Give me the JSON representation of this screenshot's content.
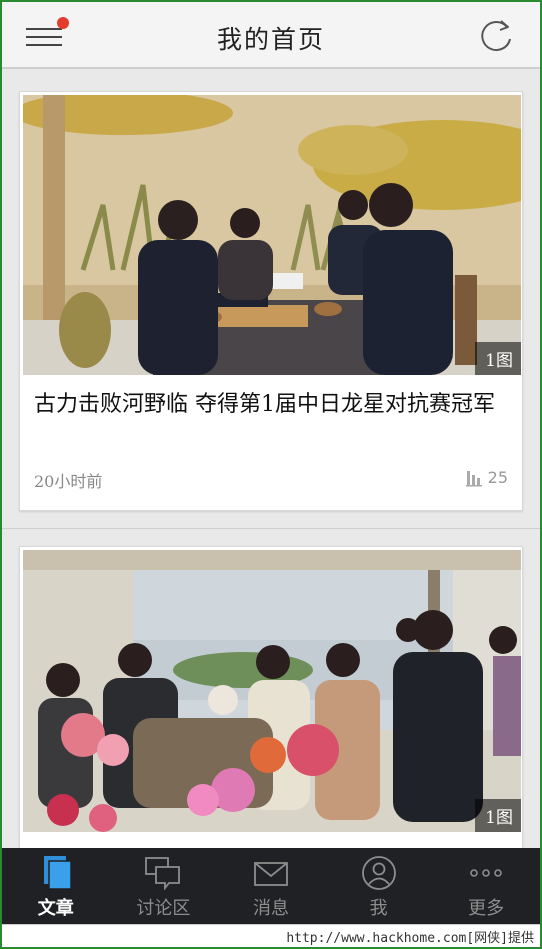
{
  "header": {
    "title": "我的首页",
    "menu_icon": "hamburger-menu-icon",
    "notification_dot_color": "#e33b2c",
    "refresh_icon": "refresh-icon"
  },
  "articles": [
    {
      "title": "古力击败河野临 夺得第1届中日龙星对抗赛冠军",
      "image_count": "1图",
      "time": "20小时前",
      "views": "25"
    },
    {
      "title": "",
      "image_count": "1图",
      "time": "",
      "views": ""
    }
  ],
  "tabbar": {
    "items": [
      {
        "label": "文章",
        "icon": "document-icon",
        "active": true
      },
      {
        "label": "讨论区",
        "icon": "chat-bubbles-icon",
        "active": false
      },
      {
        "label": "消息",
        "icon": "envelope-icon",
        "active": false
      },
      {
        "label": "我",
        "icon": "user-icon",
        "active": false
      },
      {
        "label": "更多",
        "icon": "more-dots-icon",
        "active": false
      }
    ],
    "active_color": "#ffffff",
    "inactive_color": "#8d8d8d",
    "background": "#1f2124"
  },
  "watermark": {
    "text": "http://www.hackhome.com[网侠]提供"
  }
}
